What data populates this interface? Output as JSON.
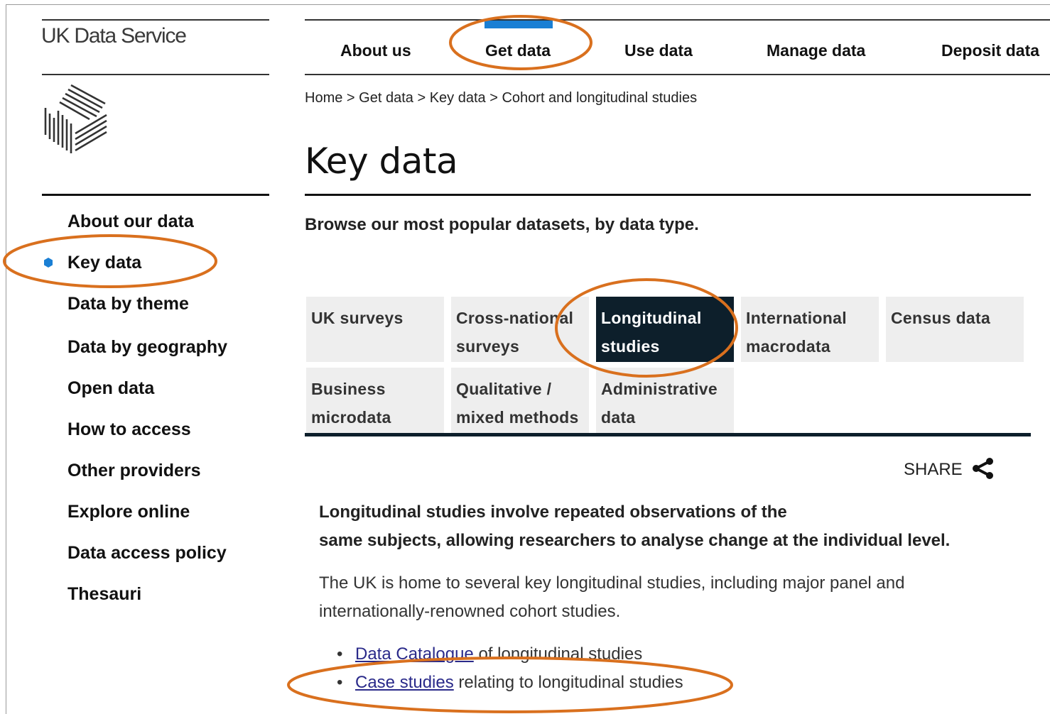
{
  "brand": {
    "name": "UK Data Service",
    "logo": "ukds-cube-logo"
  },
  "top_nav": {
    "items": [
      {
        "label": "About us"
      },
      {
        "label": "Get data",
        "active": true
      },
      {
        "label": "Use data"
      },
      {
        "label": "Manage data"
      },
      {
        "label": "Deposit data"
      }
    ]
  },
  "breadcrumb": {
    "items": [
      "Home",
      "Get data",
      "Key data",
      "Cohort and longitudinal studies"
    ],
    "separator": ">"
  },
  "page": {
    "title": "Key data",
    "intro": "Browse our most popular datasets, by data type."
  },
  "side_nav": {
    "items": [
      {
        "label": "About our data"
      },
      {
        "label": "Key data",
        "active": true
      },
      {
        "label": "Data by theme"
      },
      {
        "label": "Data by geography"
      },
      {
        "label": "Open data"
      },
      {
        "label": "How to access"
      },
      {
        "label": "Other providers"
      },
      {
        "label": "Explore online"
      },
      {
        "label": "Data access policy"
      },
      {
        "label": "Thesauri"
      }
    ]
  },
  "tabs": {
    "items": [
      {
        "lines": [
          "UK surveys"
        ]
      },
      {
        "lines": [
          "Cross-national",
          "surveys"
        ]
      },
      {
        "lines": [
          "Longitudinal",
          "studies"
        ],
        "active": true
      },
      {
        "lines": [
          "International",
          "macrodata"
        ]
      },
      {
        "lines": [
          "Census data"
        ]
      },
      {
        "lines": [
          "Business",
          "microdata"
        ]
      },
      {
        "lines": [
          "Qualitative /",
          "mixed methods"
        ]
      },
      {
        "lines": [
          "Administrative",
          "data"
        ]
      }
    ]
  },
  "share": {
    "label": "SHARE",
    "icon": "share-icon"
  },
  "content": {
    "lead_lines": [
      "Longitudinal studies involve repeated observations of the",
      "same subjects, allowing researchers to analyse change at the individual level."
    ],
    "para_lines": [
      "The UK is home to several key longitudinal studies, including major panel and",
      "internationally-renowned cohort studies."
    ],
    "links": [
      {
        "bullet": "•",
        "link_text": "Data Catalogue",
        "rest": " of longitudinal studies"
      },
      {
        "bullet": "•",
        "link_text": "Case studies",
        "rest": " relating to longitudinal studies"
      }
    ]
  },
  "colors": {
    "accent_blue": "#1a7fd4",
    "active_tab_bg": "#0d1f2b",
    "annotation_orange": "#d9701e",
    "rule_dark": "#0d1f2b"
  }
}
